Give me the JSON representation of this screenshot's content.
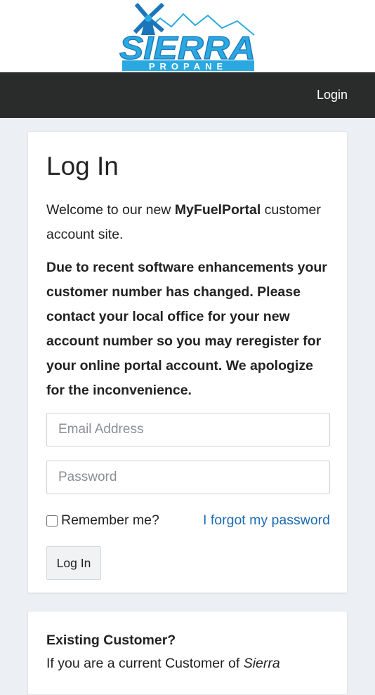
{
  "brand": {
    "logo_top": "SIERRA",
    "logo_bottom": "PROPANE",
    "primary_color": "#29a9e0",
    "dark_color": "#1b75bb"
  },
  "nav": {
    "login_link": "Login"
  },
  "login_card": {
    "title": "Log In",
    "welcome_prefix": "Welcome to our new ",
    "welcome_brand": "MyFuelPortal",
    "welcome_suffix": " customer account site.",
    "notice": "Due to recent software enhancements your customer number has changed. Please contact your local office for your new account number so you may reregister for your online portal account. We apologize for the inconvenience.",
    "email_placeholder": "Email Address",
    "password_placeholder": "Password",
    "remember_label": "Remember me?",
    "forgot_link": "I forgot my password",
    "submit_label": "Log In"
  },
  "existing_card": {
    "title": "Existing Customer?",
    "text_prefix": "If you are a current Customer of ",
    "text_company": "Sierra"
  }
}
